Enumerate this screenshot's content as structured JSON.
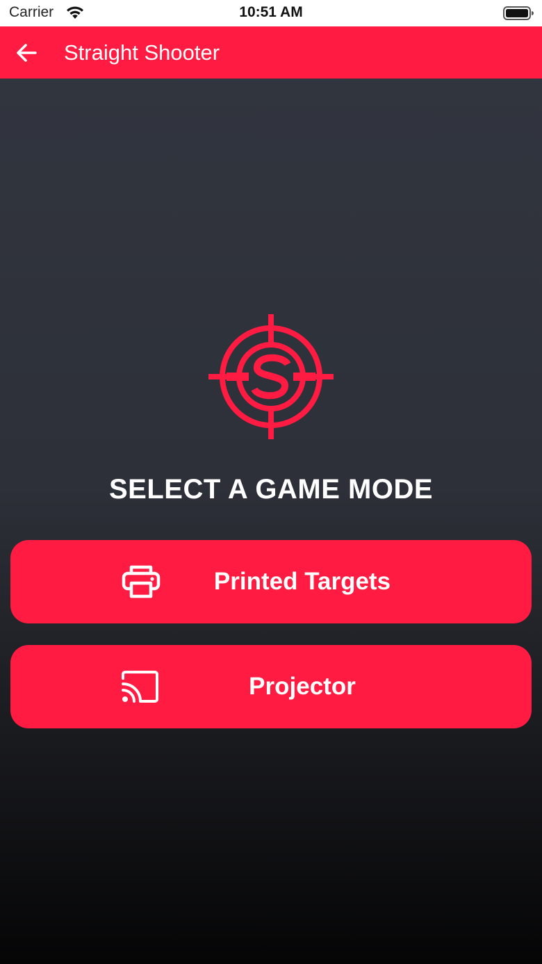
{
  "status_bar": {
    "carrier": "Carrier",
    "time": "10:51 AM",
    "icons": [
      "wifi-icon",
      "battery-icon"
    ]
  },
  "app_bar": {
    "title": "Straight Shooter",
    "back_icon": "arrow-left-icon"
  },
  "logo": {
    "icon": "target-s-logo",
    "color": "#ff1b42"
  },
  "main": {
    "heading": "SELECT A GAME MODE",
    "modes": [
      {
        "label": "Printed Targets",
        "icon": "printer-icon"
      },
      {
        "label": "Projector",
        "icon": "cast-icon"
      }
    ]
  },
  "colors": {
    "accent": "#ff1b42",
    "background_top": "#323640",
    "background_bottom": "#050506",
    "text": "#ffffff"
  }
}
